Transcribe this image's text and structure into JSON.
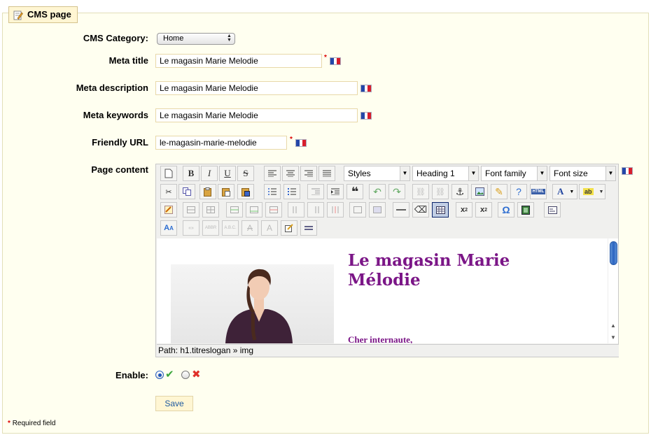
{
  "legend": {
    "title": "CMS page"
  },
  "form": {
    "category_label": "CMS Category:",
    "category_value": "Home",
    "meta_title_label": "Meta title",
    "meta_title_value": "Le magasin Marie Melodie",
    "meta_description_label": "Meta description",
    "meta_description_value": "Le magasin Marie Melodie",
    "meta_keywords_label": "Meta keywords",
    "meta_keywords_value": "Le magasin Marie Melodie",
    "friendly_url_label": "Friendly URL",
    "friendly_url_value": "le-magasin-marie-melodie",
    "page_content_label": "Page content",
    "enable_label": "Enable:",
    "enable_value": "yes",
    "required_marker": "*"
  },
  "editor": {
    "styles_label": "Styles",
    "format_label": "Heading 1",
    "font_family_label": "Font family",
    "font_size_label": "Font size",
    "content_heading": "Le magasin Marie Mélodie",
    "content_greeting": "Cher internaute,",
    "path": "Path: h1.titreslogan » img"
  },
  "actions": {
    "save_label": "Save"
  },
  "footer": {
    "required_note": "Required field",
    "required_marker": "*"
  },
  "colors": {
    "heading": "#7b1687",
    "accent": "#1e5aa0",
    "background": "#fffff0"
  }
}
